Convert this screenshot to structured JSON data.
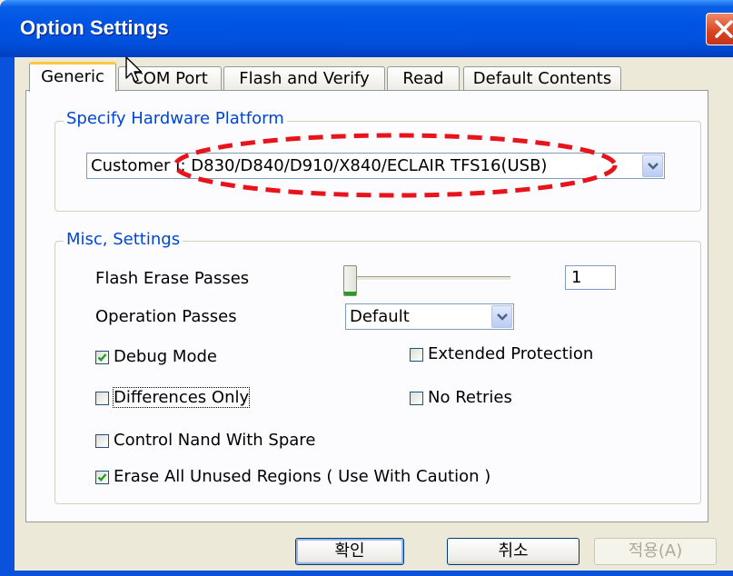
{
  "window": {
    "title": "Option Settings"
  },
  "tabs": [
    {
      "label": "Generic",
      "active": true
    },
    {
      "label": "COM Port",
      "active": false
    },
    {
      "label": "Flash and Verify",
      "active": false
    },
    {
      "label": "Read",
      "active": false
    },
    {
      "label": "Default Contents",
      "active": false
    }
  ],
  "hardware_group": {
    "title": "Specify Hardware Platform",
    "platform_value": "Customer I: D830/D840/D910/X840/ECLAIR TFS16(USB)"
  },
  "misc_group": {
    "title": "Misc, Settings",
    "flash_erase_passes_label": "Flash Erase Passes",
    "flash_erase_passes_value": "1",
    "operation_passes_label": "Operation Passes",
    "operation_passes_value": "Default",
    "checkboxes": {
      "debug_mode": {
        "label": "Debug Mode",
        "checked": true
      },
      "extended_protection": {
        "label": "Extended Protection",
        "checked": false
      },
      "differences_only": {
        "label": "Differences Only",
        "checked": false
      },
      "no_retries": {
        "label": "No Retries",
        "checked": false
      },
      "control_nand": {
        "label": "Control Nand With Spare",
        "checked": false
      },
      "erase_unused": {
        "label": "Erase All Unused Regions ( Use With Caution )",
        "checked": true
      }
    }
  },
  "buttons": {
    "ok": "확인",
    "cancel": "취소",
    "apply": "적용(A)"
  },
  "colors": {
    "titlebar": "#0054e3",
    "groupbox_title": "#0046d5",
    "tab_highlight": "#ffc83c",
    "annotation": "#e8141c",
    "checkmark": "#21a121"
  }
}
